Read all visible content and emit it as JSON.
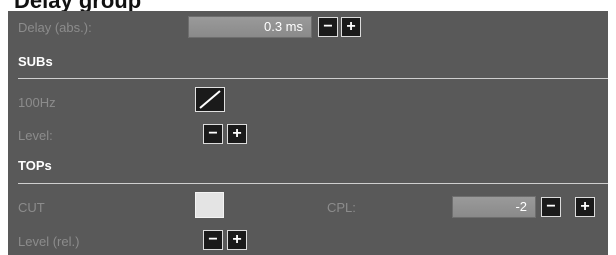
{
  "header": {
    "title": "Delay group"
  },
  "delay": {
    "label": "Delay (abs.):",
    "value": "0.3 ms",
    "minus": "−",
    "plus": "+"
  },
  "subs": {
    "title": "SUBs",
    "freq_label": "100Hz",
    "level_label": "Level:",
    "minus": "−",
    "plus": "+"
  },
  "tops": {
    "title": "TOPs",
    "cut_label": "CUT",
    "cpl_label": "CPL:",
    "cpl_value": "-2",
    "cpl_minus": "−",
    "cpl_plus": "+",
    "level_label": "Level (rel.)",
    "minus": "−",
    "plus": "+"
  },
  "icons": {
    "slope": "slope-icon",
    "checkbox": "checkbox-icon"
  }
}
